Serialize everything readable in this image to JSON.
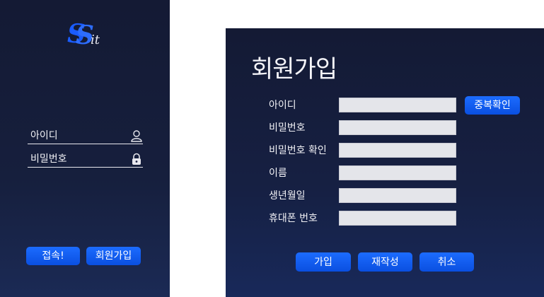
{
  "login": {
    "logo": "SSit",
    "fields": [
      {
        "label": "아이디",
        "icon": "user-icon"
      },
      {
        "label": "비밀번호",
        "icon": "lock-icon"
      }
    ],
    "connect_label": "접속!",
    "signup_label": "회원가입"
  },
  "signup": {
    "title": "회원가입",
    "id_label": "아이디",
    "id_value": "",
    "check_label": "중복확인",
    "password_label": "비밀번호",
    "password_value": "",
    "password_confirm_label": "비밀번호 확인",
    "password_confirm_value": "",
    "name_label": "이름",
    "name_value": "",
    "birth_label": "생년월일",
    "birth_value": "",
    "phone_label": "휴대폰 번호",
    "phone_value": "",
    "join_label": "가입",
    "rewrite_label": "재작성",
    "cancel_label": "취소"
  },
  "colors": {
    "panel": "#141a34",
    "accent": "#1c6cff",
    "input": "#e4e5ea",
    "text": "#f2f2f6"
  }
}
